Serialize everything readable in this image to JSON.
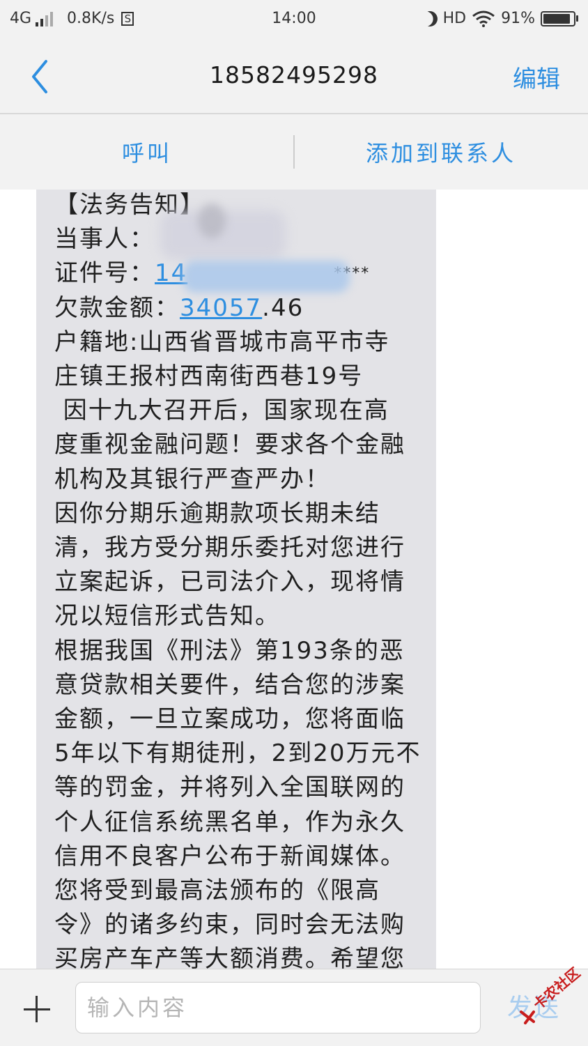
{
  "status_bar": {
    "network": "4G",
    "speed": "0.8K/s",
    "s_icon": "S",
    "time": "14:00",
    "hd": "HD",
    "battery": "91%",
    "battery_level": 0.91
  },
  "nav": {
    "title": "18582495298",
    "edit_label": "编辑"
  },
  "actions": {
    "call_label": "呼叫",
    "add_contact_label": "添加到联系人"
  },
  "message": {
    "line_01": "【法务告知】",
    "line_02_prefix": "当事人：",
    "line_03_prefix": "证件号：",
    "line_03_link": "14",
    "line_03_suffix": "****",
    "line_04_prefix": "欠款金额：",
    "line_04_link": "34057",
    "line_04_suffix": ".46",
    "line_05": "户籍地:山西省晋城市高平市寺",
    "line_06": "庄镇王报村西南街西巷19号",
    "line_07": " 因十九大召开后，国家现在高",
    "line_08": "度重视金融问题！要求各个金融",
    "line_09": "机构及其银行严查严办！",
    "line_10": "因你分期乐逾期款项长期未结",
    "line_11": "清，我方受分期乐委托对您进行",
    "line_12": "立案起诉，已司法介入，现将情",
    "line_13": "况以短信形式告知。",
    "line_14": "根据我国《刑法》第193条的恶",
    "line_15": "意贷款相关要件，结合您的涉案",
    "line_16": "金额，一旦立案成功，您将面临",
    "line_17": "5年以下有期徒刑，2到20万元不",
    "line_18": "等的罚金，并将列入全国联网的",
    "line_19": "个人征信系统黑名单，作为永久",
    "line_20": "信用不良客户公布于新闻媒体。",
    "line_21": "您将受到最高法颁布的《限高",
    "line_22": "令》的诸多约束，同时会无法购",
    "line_23": "买房产车产等大额消费。希望您"
  },
  "input_bar": {
    "placeholder": "输入内容",
    "send_label": "发送"
  },
  "watermark": {
    "text": "卡农社区"
  },
  "colors": {
    "accent": "#2d8ee0",
    "bubble": "#e3e3e7",
    "background": "#f2f2f2"
  },
  "icons": [
    "back-arrow-icon",
    "plus-icon",
    "wifi-icon",
    "moon-icon",
    "battery-icon",
    "signal-icon"
  ]
}
